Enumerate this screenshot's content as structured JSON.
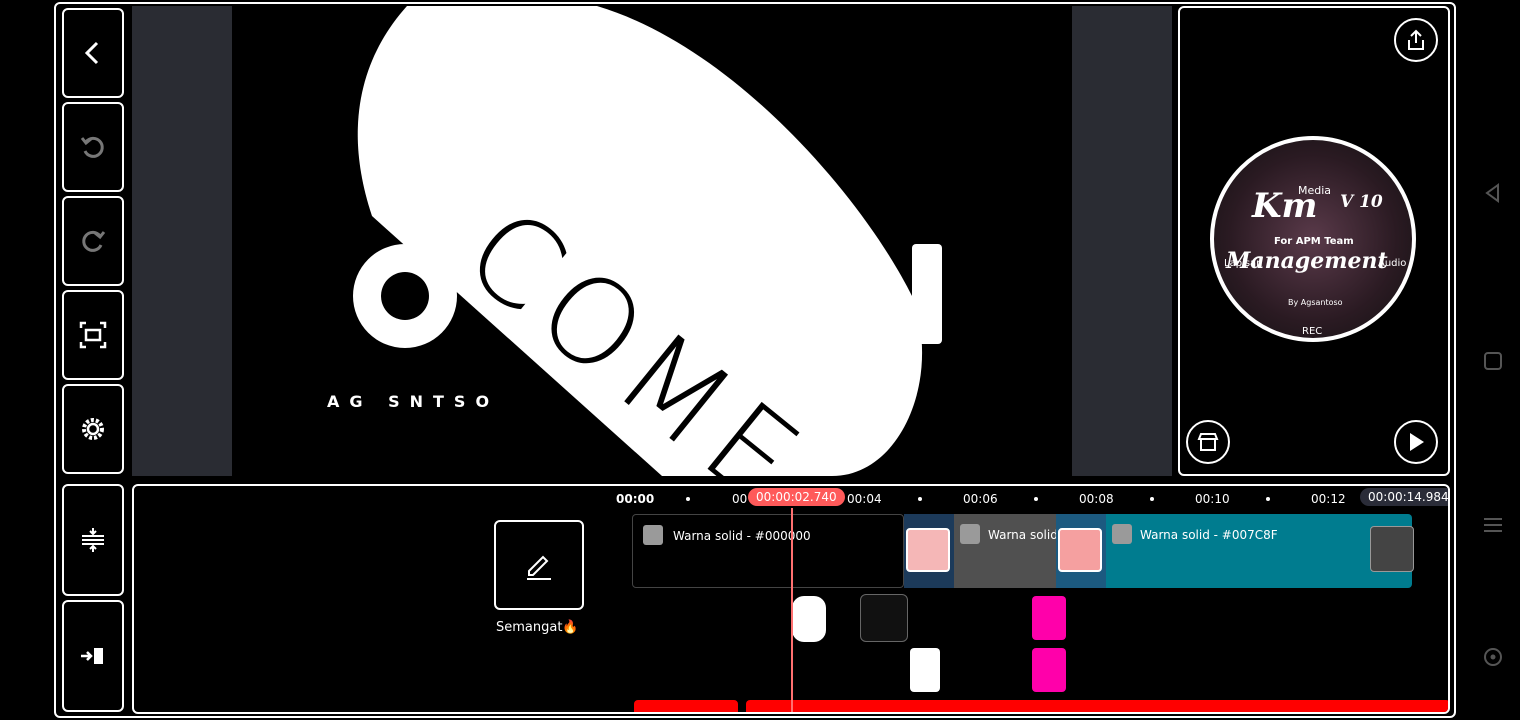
{
  "preview": {
    "main_text": "COME",
    "sub_text": "AG SNTSO"
  },
  "right_panel": {
    "logo_title": "Km",
    "logo_version": "V 10",
    "logo_subtitle": "For APM Team",
    "logo_main": "Management",
    "logo_byline": "By Agsantoso",
    "menu_media": "Media",
    "menu_layer": "Lapisan",
    "menu_audio": "Audio",
    "menu_rec": "REC"
  },
  "timeline": {
    "ruler": [
      "00:00",
      "00",
      "00:04",
      "00:06",
      "00:08",
      "00:10",
      "00:12"
    ],
    "current_time": "00:00:02.740",
    "total_time": "00:00:14.984",
    "clip_label": "Semangat🔥",
    "segments": {
      "seg1": "Warna solid - #000000",
      "seg2": "Warna solid",
      "seg3": "Warna solid - #007C8F"
    }
  },
  "colors": {
    "playhead": "#ff5a5a",
    "teal_clip": "#007C8F",
    "pink_layer": "#ff00aa",
    "red_audio": "#ff0000"
  },
  "icons": {
    "back": "chevron-left-icon",
    "undo": "undo-icon",
    "redo": "redo-icon",
    "fullscreen": "fullscreen-icon",
    "settings": "gear-icon",
    "split": "split-icon",
    "export": "share-icon",
    "store": "store-icon",
    "play": "play-icon"
  }
}
